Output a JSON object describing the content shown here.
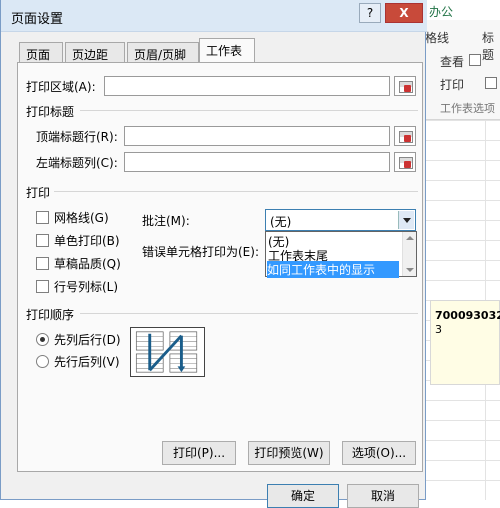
{
  "background": {
    "ribbon_tab": "办公",
    "labels": [
      "格线",
      "标题",
      "查看",
      "打印",
      "工作表选项"
    ],
    "cell_value": "700093032",
    "cell_value2": "3"
  },
  "dialog": {
    "title": "页面设置",
    "help_label": "?",
    "close_label": "X",
    "tabs": [
      "页面",
      "页边距",
      "页眉/页脚",
      "工作表"
    ],
    "print_area_label": "打印区域(A):",
    "print_titles_label": "打印标题",
    "top_rows_label": "顶端标题行(R):",
    "left_cols_label": "左端标题列(C):",
    "print_section_label": "打印",
    "checkboxes": [
      "网格线(G)",
      "单色打印(B)",
      "草稿品质(Q)",
      "行号列标(L)"
    ],
    "comments_label": "批注(M):",
    "comments_value": "(无)",
    "errors_label": "错误单元格打印为(E):",
    "dropdown_options": [
      "(无)",
      "工作表末尾",
      "如同工作表中的显示"
    ],
    "order_label": "打印顺序",
    "order_options": [
      "先列后行(D)",
      "先行后列(V)"
    ],
    "buttons": {
      "print": "打印(P)...",
      "preview": "打印预览(W)",
      "options": "选项(O)...",
      "ok": "确定",
      "cancel": "取消"
    }
  }
}
